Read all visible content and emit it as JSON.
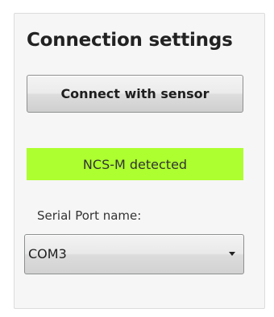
{
  "panel": {
    "title": "Connection settings",
    "connect_button_label": "Connect with sensor",
    "status_text": "NCS-M detected",
    "status_color": "#adff2f",
    "port_label": "Serial Port name:",
    "port_selected": "COM3",
    "port_dropdown_icon": "chevron-down-icon"
  }
}
